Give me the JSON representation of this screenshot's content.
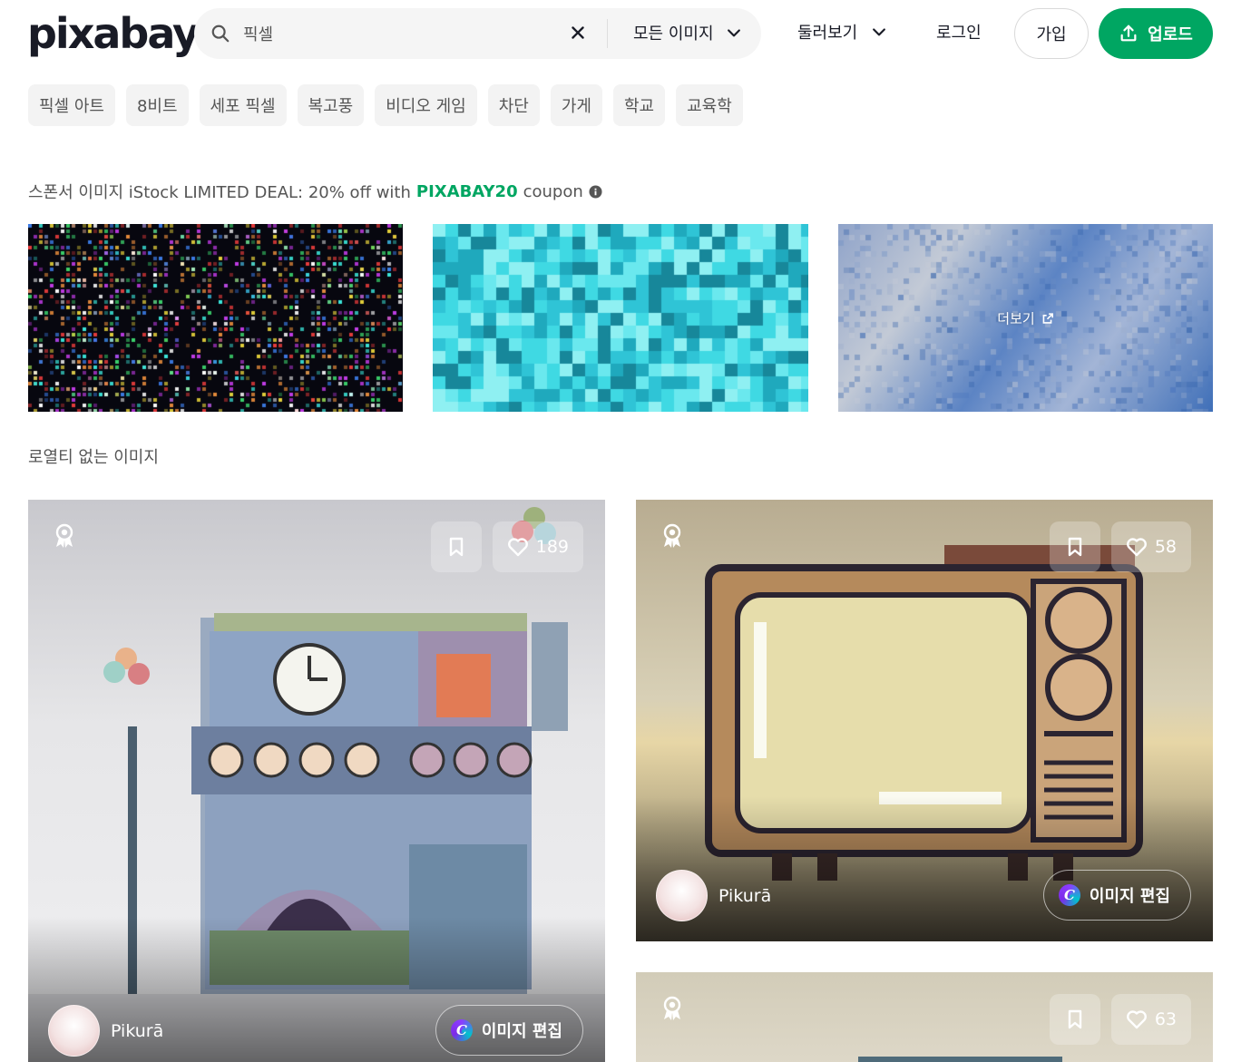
{
  "header": {
    "logo_text": "pixabay",
    "search": {
      "value": "픽셀",
      "placeholder": "",
      "type_filter": "모든 이미지"
    },
    "explore_label": "둘러보기",
    "login_label": "로그인",
    "join_label": "가입",
    "upload_label": "업로드"
  },
  "chips": [
    "픽셀 아트",
    "8비트",
    "세포 픽셀",
    "복고풍",
    "비디오 게임",
    "차단",
    "가게",
    "학교",
    "교육학"
  ],
  "sponsor": {
    "prefix": "스폰서 이미지 iStock LIMITED DEAL: 20% off with",
    "coupon": "PIXABAY20",
    "suffix": "coupon",
    "more_label": "더보기"
  },
  "section_title": "로열티 없는 이미지",
  "cards": [
    {
      "likes": "189",
      "author": "Pikurā",
      "edit_label": "이미지 편집"
    },
    {
      "likes": "58",
      "author": "Pikurā",
      "edit_label": "이미지 편집"
    },
    {
      "likes": "63"
    }
  ],
  "colors": {
    "brand_green": "#00a662",
    "text_dark": "#191b26",
    "text_muted": "#555555",
    "chip_bg": "#f3f3f3"
  }
}
